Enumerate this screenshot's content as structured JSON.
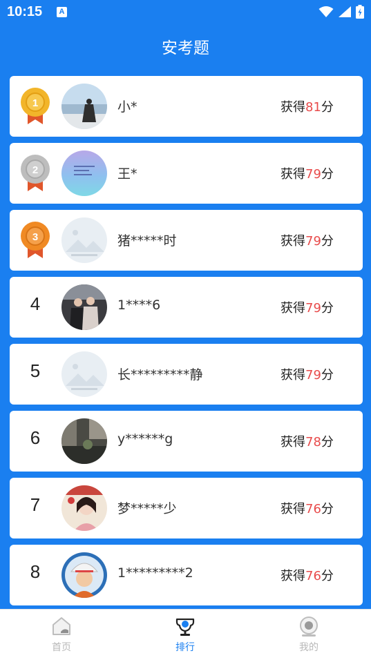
{
  "status_bar": {
    "time": "10:15",
    "notification_letter": "A"
  },
  "header": {
    "title": "安考题"
  },
  "ranking": [
    {
      "rank": "1",
      "medal": "gold",
      "name": "小*",
      "score_prefix": "获得",
      "score": "81",
      "score_suffix": "分",
      "avatar": "photo-beach"
    },
    {
      "rank": "2",
      "medal": "silver",
      "name": "王*",
      "score_prefix": "获得",
      "score": "79",
      "score_suffix": "分",
      "avatar": "photo-blue-sky"
    },
    {
      "rank": "3",
      "medal": "bronze",
      "name": "猪*****时",
      "score_prefix": "获得",
      "score": "79",
      "score_suffix": "分",
      "avatar": "placeholder-image"
    },
    {
      "rank": "4",
      "medal": "",
      "name": "1****6",
      "score_prefix": "获得",
      "score": "79",
      "score_suffix": "分",
      "avatar": "photo-group"
    },
    {
      "rank": "5",
      "medal": "",
      "name": "长*********静",
      "score_prefix": "获得",
      "score": "79",
      "score_suffix": "分",
      "avatar": "placeholder-image"
    },
    {
      "rank": "6",
      "medal": "",
      "name": "y******g",
      "score_prefix": "获得",
      "score": "78",
      "score_suffix": "分",
      "avatar": "photo-street"
    },
    {
      "rank": "7",
      "medal": "",
      "name": "梦*****少",
      "score_prefix": "获得",
      "score": "76",
      "score_suffix": "分",
      "avatar": "photo-portrait"
    },
    {
      "rank": "8",
      "medal": "",
      "name": "1*********2",
      "score_prefix": "获得",
      "score": "76",
      "score_suffix": "分",
      "avatar": "cartoon-worker"
    }
  ],
  "tabbar": {
    "items": [
      {
        "label": "首页",
        "icon": "home-icon",
        "active": false
      },
      {
        "label": "排行",
        "icon": "trophy-icon",
        "active": true
      },
      {
        "label": "我的",
        "icon": "profile-icon",
        "active": false
      }
    ]
  },
  "colors": {
    "primary": "#1a7ff0",
    "score": "#e84b4b",
    "gold": "#f2b52a",
    "silver": "#bdbdbd",
    "bronze": "#f08a24",
    "ribbon": "#e0562b"
  }
}
